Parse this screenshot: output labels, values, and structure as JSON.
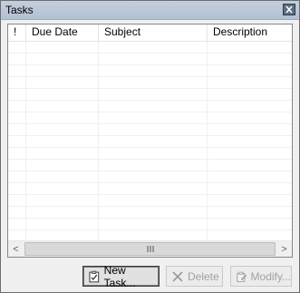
{
  "window": {
    "title": "Tasks"
  },
  "columns": [
    {
      "label": "!"
    },
    {
      "label": "Due Date"
    },
    {
      "label": "Subject"
    },
    {
      "label": "Description"
    }
  ],
  "rows": [],
  "buttons": {
    "new_task": "New Task...",
    "delete": "Delete",
    "modify": "Modify..."
  },
  "icons": {
    "close": "close-icon",
    "new_task": "clipboard-check-icon",
    "delete": "x-icon",
    "modify": "edit-document-icon",
    "scroll_left": "chevron-left-icon",
    "scroll_right": "chevron-right-icon"
  },
  "scrollbar": {
    "left_arrow": "<",
    "right_arrow": ">"
  }
}
